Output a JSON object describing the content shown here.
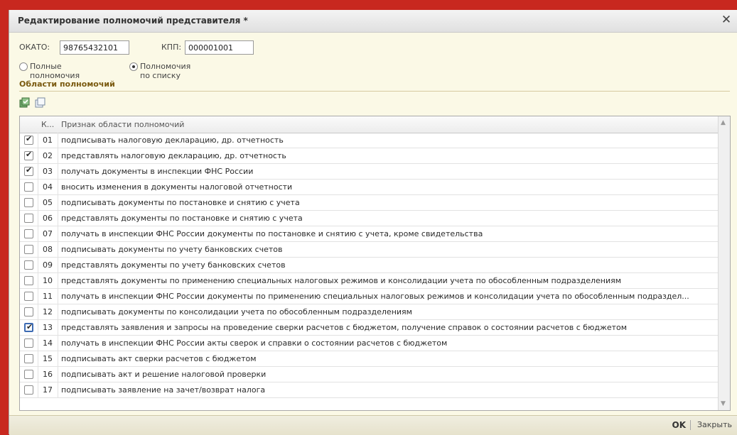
{
  "window": {
    "title": "Редактирование полномочий представителя *"
  },
  "fields": {
    "okato_label": "ОКАТО:",
    "okato_value": "98765432101",
    "kpp_label": "КПП:",
    "kpp_value": "000001001"
  },
  "mode": {
    "full_label": "Полные полномочия",
    "list_label": "Полномочия по списку",
    "selected": "list"
  },
  "section": {
    "title": "Области полномочий"
  },
  "toolbar": {
    "check_all_icon": "check-all-icon",
    "uncheck_all_icon": "uncheck-all-icon"
  },
  "table": {
    "headers": {
      "code": "К...",
      "name": "Признак области полномочий"
    },
    "rows": [
      {
        "checked": true,
        "code": "01",
        "name": "подписывать налоговую декларацию, др. отчетность"
      },
      {
        "checked": true,
        "code": "02",
        "name": "представлять налоговую декларацию, др. отчетность"
      },
      {
        "checked": true,
        "code": "03",
        "name": "получать документы в инспекции ФНС России"
      },
      {
        "checked": false,
        "code": "04",
        "name": "вносить изменения в документы налоговой отчетности"
      },
      {
        "checked": false,
        "code": "05",
        "name": "подписывать документы по постановке и снятию с учета"
      },
      {
        "checked": false,
        "code": "06",
        "name": "представлять документы по постановке и снятию с учета"
      },
      {
        "checked": false,
        "code": "07",
        "name": "получать в инспекции ФНС России документы по постановке и снятию с учета, кроме свидетельства"
      },
      {
        "checked": false,
        "code": "08",
        "name": "подписывать документы по учету банковских счетов"
      },
      {
        "checked": false,
        "code": "09",
        "name": "представлять документы по учету банковских счетов"
      },
      {
        "checked": false,
        "code": "10",
        "name": "представлять документы по применению специальных налоговых режимов и консолидации учета по обособленным подразделениям"
      },
      {
        "checked": false,
        "code": "11",
        "name": "получать в инспекции ФНС России документы по применению специальных налоговых режимов и консолидации учета по обособленным подраздел..."
      },
      {
        "checked": false,
        "code": "12",
        "name": "подписывать документы по консолидации учета по обособленным подразделениям"
      },
      {
        "checked": true,
        "focused": true,
        "code": "13",
        "name": "представлять заявления и запросы на проведение сверки расчетов с бюджетом, получение справок о состоянии расчетов с бюджетом"
      },
      {
        "checked": false,
        "code": "14",
        "name": "получать в инспекции ФНС России акты сверок и справки о состоянии расчетов с бюджетом"
      },
      {
        "checked": false,
        "code": "15",
        "name": "подписывать акт сверки расчетов с бюджетом"
      },
      {
        "checked": false,
        "code": "16",
        "name": "подписывать акт и решение налоговой проверки"
      },
      {
        "checked": false,
        "code": "17",
        "name": "подписывать заявление на зачет/возврат налога"
      }
    ]
  },
  "footer": {
    "ok_label": "OK",
    "close_label": "Закрыть"
  }
}
